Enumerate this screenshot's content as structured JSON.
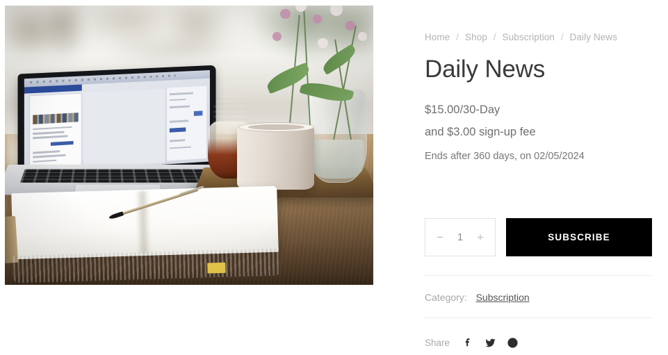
{
  "breadcrumb": {
    "items": [
      {
        "label": "Home"
      },
      {
        "label": "Shop"
      },
      {
        "label": "Subscription"
      },
      {
        "label": "Daily News"
      }
    ],
    "separator": "/"
  },
  "product": {
    "title": "Daily News",
    "price": "$15.00/30-Day",
    "signup_fee": "and $3.00 sign-up fee",
    "ends_note": "Ends after 360 days, on 02/05/2024",
    "image_alt": "Laptop, open notebook with pen, mug on wooden tray and flowers in a glass vase on a desk by a window"
  },
  "purchase": {
    "decrease_label": "−",
    "quantity": "1",
    "increase_label": "+",
    "submit_label": "SUBSCRIBE",
    "submit_bg": "#000000",
    "submit_color": "#ffffff"
  },
  "meta": {
    "category_label": "Category:",
    "category_value": "Subscription"
  },
  "share": {
    "label": "Share",
    "networks": [
      {
        "name": "facebook",
        "icon": "facebook-icon"
      },
      {
        "name": "twitter",
        "icon": "twitter-icon"
      },
      {
        "name": "pinterest",
        "icon": "pinterest-icon"
      }
    ]
  },
  "theme": {
    "page_bg": "#ffffff",
    "title_color": "#3a3a3a",
    "muted_color": "#b3b3b3",
    "body_color": "#6f6f6f",
    "divider_color": "#ececec",
    "accent": "#000000"
  }
}
